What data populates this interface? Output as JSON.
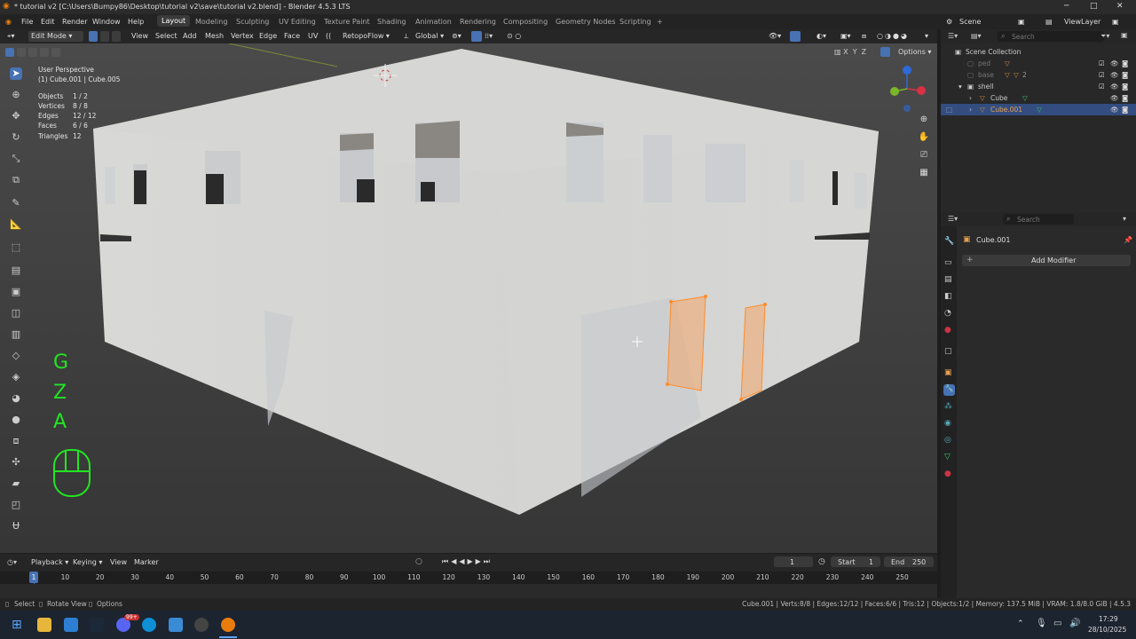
{
  "window": {
    "title": "* tutorial v2 [C:\\Users\\Bumpy86\\Desktop\\tutorial v2\\save\\tutorial v2.blend] - Blender 4.5.3 LTS",
    "min": "─",
    "max": "□",
    "close": "✕"
  },
  "menu": {
    "items": [
      "File",
      "Edit",
      "Render",
      "Window",
      "Help"
    ],
    "workspaces": [
      "Layout",
      "Modeling",
      "Sculpting",
      "UV Editing",
      "Texture Paint",
      "Shading",
      "Animation",
      "Rendering",
      "Compositing",
      "Geometry Nodes",
      "Scripting",
      "+"
    ],
    "active_workspace": "Layout",
    "scene": "Scene",
    "view_layer": "ViewLayer"
  },
  "viewport_header": {
    "mode": "Edit Mode",
    "menus": [
      "View",
      "Select",
      "Add",
      "Mesh",
      "Vertex",
      "Edge",
      "Face",
      "UV"
    ],
    "retopoflow": "RetopoFlow",
    "transform": "Global",
    "options": "Options",
    "axes": [
      "X",
      "Y",
      "Z"
    ]
  },
  "overlay": {
    "perspective": "User Perspective",
    "object": "(1) Cube.001 | Cube.005",
    "stats": [
      {
        "label": "Objects",
        "value": "1 / 2"
      },
      {
        "label": "Vertices",
        "value": "8 / 8"
      },
      {
        "label": "Edges",
        "value": "12 / 12"
      },
      {
        "label": "Faces",
        "value": "6 / 6"
      },
      {
        "label": "Triangles",
        "value": "12"
      }
    ],
    "key_hints": [
      "G",
      "Z",
      "A"
    ]
  },
  "outliner": {
    "search_placeholder": "Search",
    "root": "Scene Collection",
    "rows": [
      {
        "name": "ped",
        "dim": true
      },
      {
        "name": "base",
        "dim": true,
        "badge": "2"
      },
      {
        "name": "shell",
        "dim": false
      },
      {
        "name": "Cube",
        "dim": false
      },
      {
        "name": "Cube.001",
        "dim": false,
        "selected": true
      }
    ]
  },
  "properties": {
    "search_placeholder": "Search",
    "object_name": "Cube.001",
    "add_modifier": "Add Modifier"
  },
  "timeline": {
    "menus": [
      "Playback",
      "Keying",
      "View",
      "Marker"
    ],
    "current_frame": "1",
    "start_label": "Start",
    "start": "1",
    "end_label": "End",
    "end": "250",
    "ticks": [
      "1",
      "10",
      "20",
      "30",
      "40",
      "50",
      "60",
      "70",
      "80",
      "90",
      "100",
      "110",
      "120",
      "130",
      "140",
      "150",
      "160",
      "170",
      "180",
      "190",
      "200",
      "210",
      "220",
      "230",
      "240",
      "250"
    ]
  },
  "statusbar": {
    "left": [
      "Select",
      "Rotate View",
      "Options"
    ],
    "right": "Cube.001 | Verts:8/8 | Edges:12/12 | Faces:6/6 | Tris:12 | Objects:1/2 | Memory: 137.5 MiB | VRAM: 1.8/8.0 GiB | 4.5.3"
  },
  "taskbar": {
    "time": "17:29",
    "date": "28/10/2025",
    "badge": "99+"
  },
  "colors": {
    "accent": "#4772b3",
    "selection_orange": "#ff8c2a",
    "key_hint_green": "#22e522"
  }
}
